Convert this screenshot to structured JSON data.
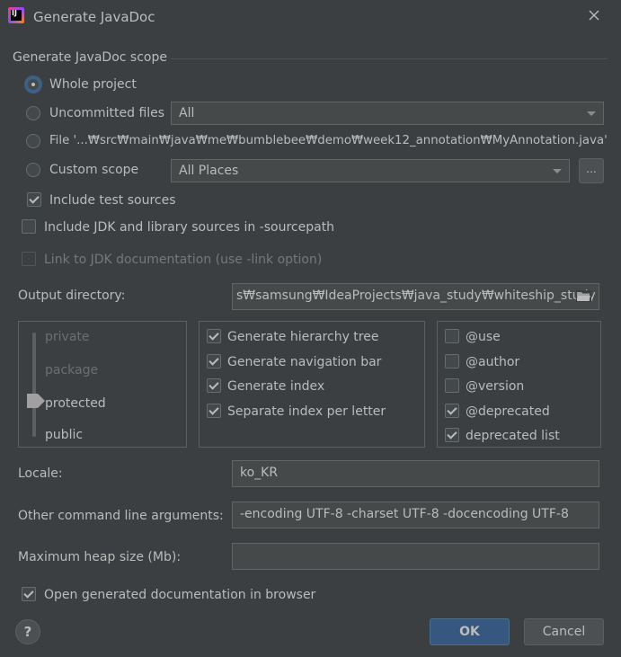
{
  "window": {
    "title": "Generate JavaDoc",
    "app_icon": "intellij-icon",
    "close_icon": "close-icon"
  },
  "scope": {
    "section_title": "Generate JavaDoc scope",
    "whole_project": "Whole project",
    "uncommitted_files": "Uncommitted files",
    "uncommitted_combo_value": "All",
    "file": "File '...₩src₩main₩java₩me₩bumblebee₩demo₩week12_annotation₩MyAnnotation.java'",
    "custom_scope": "Custom scope",
    "custom_scope_combo_value": "All Places",
    "custom_scope_more": "...",
    "selected": "whole_project",
    "include_test_sources": "Include test sources",
    "include_test_sources_checked": true
  },
  "options": {
    "include_jdk": "Include JDK and library sources in -sourcepath",
    "include_jdk_checked": false,
    "link_jdk": "Link to JDK documentation (use -link option)",
    "link_jdk_checked": false,
    "output_directory_label": "Output directory:",
    "output_directory_value": "s₩samsung₩IdeaProjects₩java_study₩whiteship_study"
  },
  "visibility": {
    "levels": [
      "private",
      "package",
      "protected",
      "public"
    ],
    "selected": "protected"
  },
  "generate": {
    "items": [
      {
        "label": "Generate hierarchy tree",
        "checked": true
      },
      {
        "label": "Generate navigation bar",
        "checked": true
      },
      {
        "label": "Generate index",
        "checked": true
      },
      {
        "label": "Separate index per letter",
        "checked": true
      }
    ]
  },
  "tags": {
    "items": [
      {
        "label": "@use",
        "checked": false
      },
      {
        "label": "@author",
        "checked": false
      },
      {
        "label": "@version",
        "checked": false
      },
      {
        "label": "@deprecated",
        "checked": true
      },
      {
        "label": "deprecated list",
        "checked": true
      }
    ]
  },
  "fields": {
    "locale_label": "Locale:",
    "locale_value": "ko_KR",
    "args_label": "Other command line arguments:",
    "args_value": "-encoding UTF-8 -charset UTF-8 -docencoding UTF-8",
    "heap_label": "Maximum heap size (Mb):",
    "heap_value": ""
  },
  "footer": {
    "open_browser": "Open generated documentation in browser",
    "open_browser_checked": true,
    "help": "?",
    "ok": "OK",
    "cancel": "Cancel"
  },
  "colors": {
    "background": "#3c3f41",
    "accent": "#365880",
    "text": "#bbbbbb"
  }
}
